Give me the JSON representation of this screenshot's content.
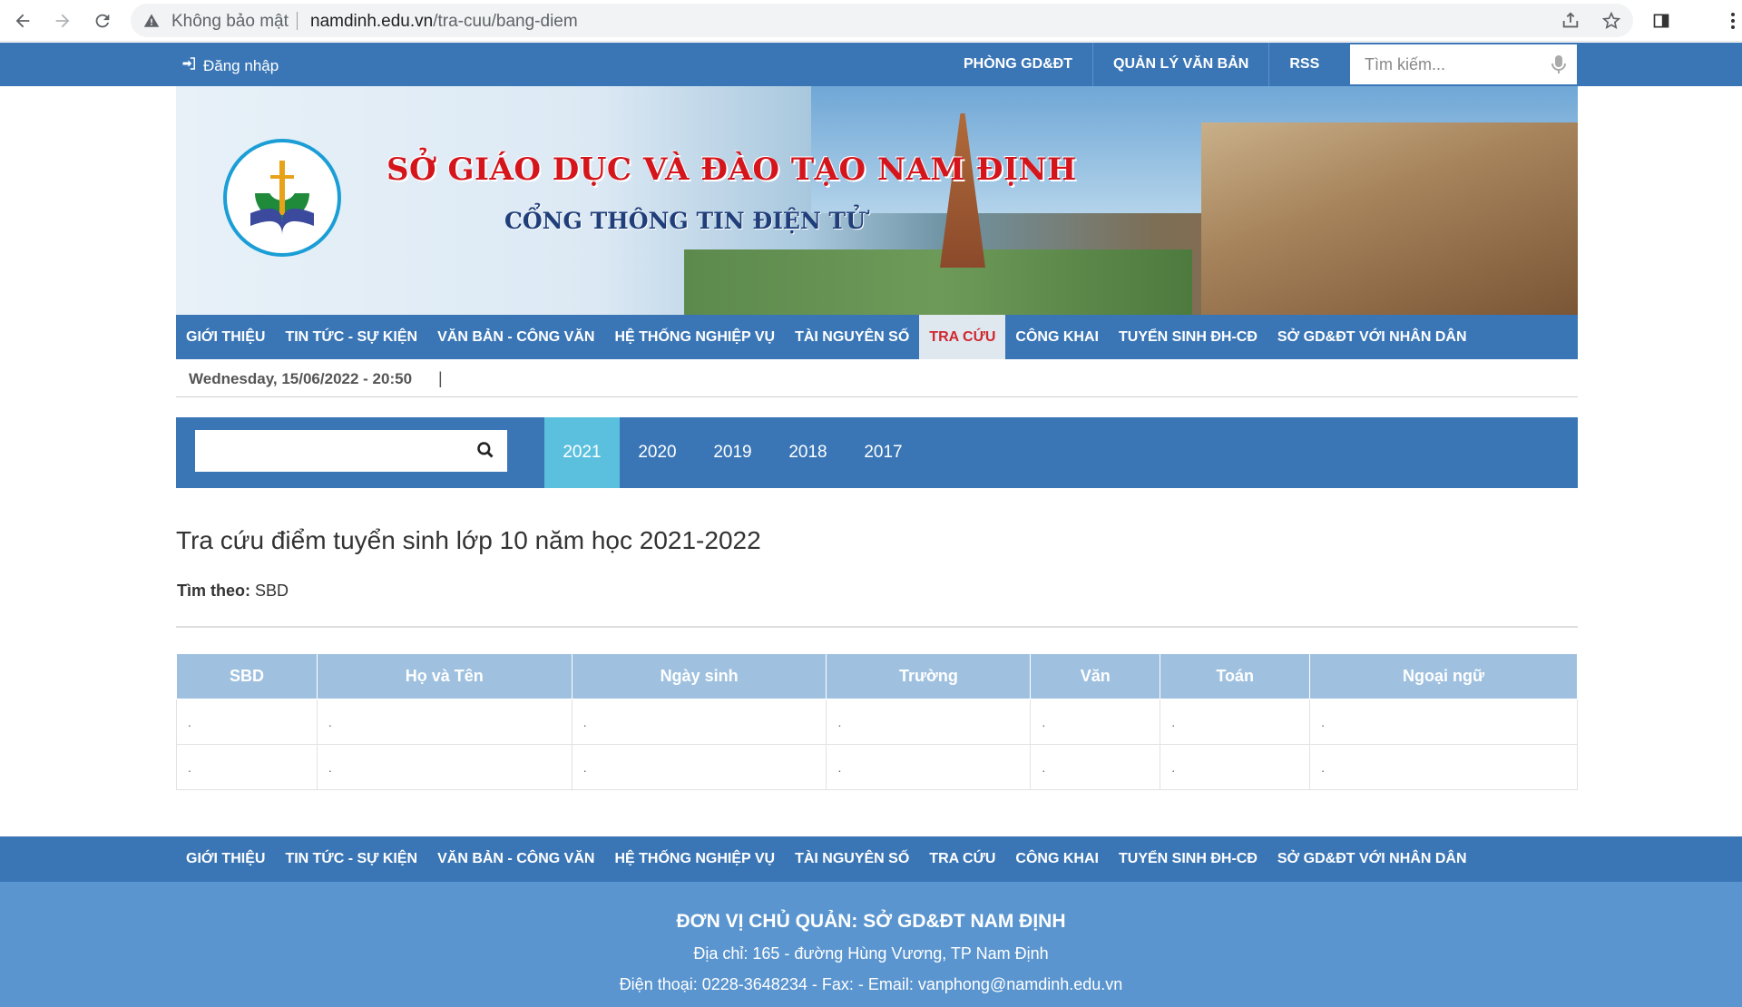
{
  "browser": {
    "security_label": "Không bảo mật",
    "url_host": "namdinh.edu.vn",
    "url_path": "/tra-cuu/bang-diem"
  },
  "topbar": {
    "login_label": "Đăng nhập",
    "links": [
      "PHÒNG GD&ĐT",
      "QUẢN LÝ VĂN BẢN",
      "RSS"
    ],
    "search_placeholder": "Tìm kiếm..."
  },
  "banner": {
    "title": "SỞ GIÁO DỤC VÀ ĐÀO TẠO NAM ĐỊNH",
    "subtitle": "CỔNG THÔNG TIN ĐIỆN TỬ"
  },
  "menu": {
    "items": [
      "GIỚI THIỆU",
      "TIN TỨC - SỰ KIỆN",
      "VĂN BẢN - CÔNG VĂN",
      "HỆ THỐNG NGHIỆP VỤ",
      "TÀI NGUYÊN SỐ",
      "TRA CỨU",
      "CÔNG KHAI",
      "TUYỂN SINH ĐH-CĐ",
      "SỞ GD&ĐT VỚI NHÂN DÂN"
    ],
    "active_index": 5
  },
  "datebar": {
    "date": "Wednesday, 15/06/2022 - 20:50",
    "separator": "|"
  },
  "years": {
    "items": [
      "2021",
      "2020",
      "2019",
      "2018",
      "2017"
    ],
    "active": "2021"
  },
  "main": {
    "title": "Tra cứu điểm tuyển sinh lớp 10 năm học 2021-2022",
    "find_by_label": "Tìm theo:",
    "find_by_value": "SBD"
  },
  "table": {
    "headers": [
      "SBD",
      "Họ và Tên",
      "Ngày sinh",
      "Trường",
      "Văn",
      "Toán",
      "Ngoại ngữ"
    ],
    "rows": [
      [
        ".",
        ".",
        ".",
        ".",
        ".",
        ".",
        "."
      ],
      [
        ".",
        ".",
        ".",
        ".",
        ".",
        ".",
        "."
      ]
    ]
  },
  "footer": {
    "org": "ĐƠN VỊ CHỦ QUẢN: SỞ GD&ĐT NAM ĐỊNH",
    "address": "Địa chỉ: 165 - đường Hùng Vương, TP Nam Định",
    "contact": "Điện thoại: 0228-3648234 - Fax:  - Email: vanphong@namdinh.edu.vn"
  },
  "colors": {
    "primary_blue": "#3a76b6",
    "active_year": "#5bc0de",
    "table_header": "#9fc1df",
    "footer_bg": "#5a95cf",
    "active_menu_text": "#d0282e"
  }
}
